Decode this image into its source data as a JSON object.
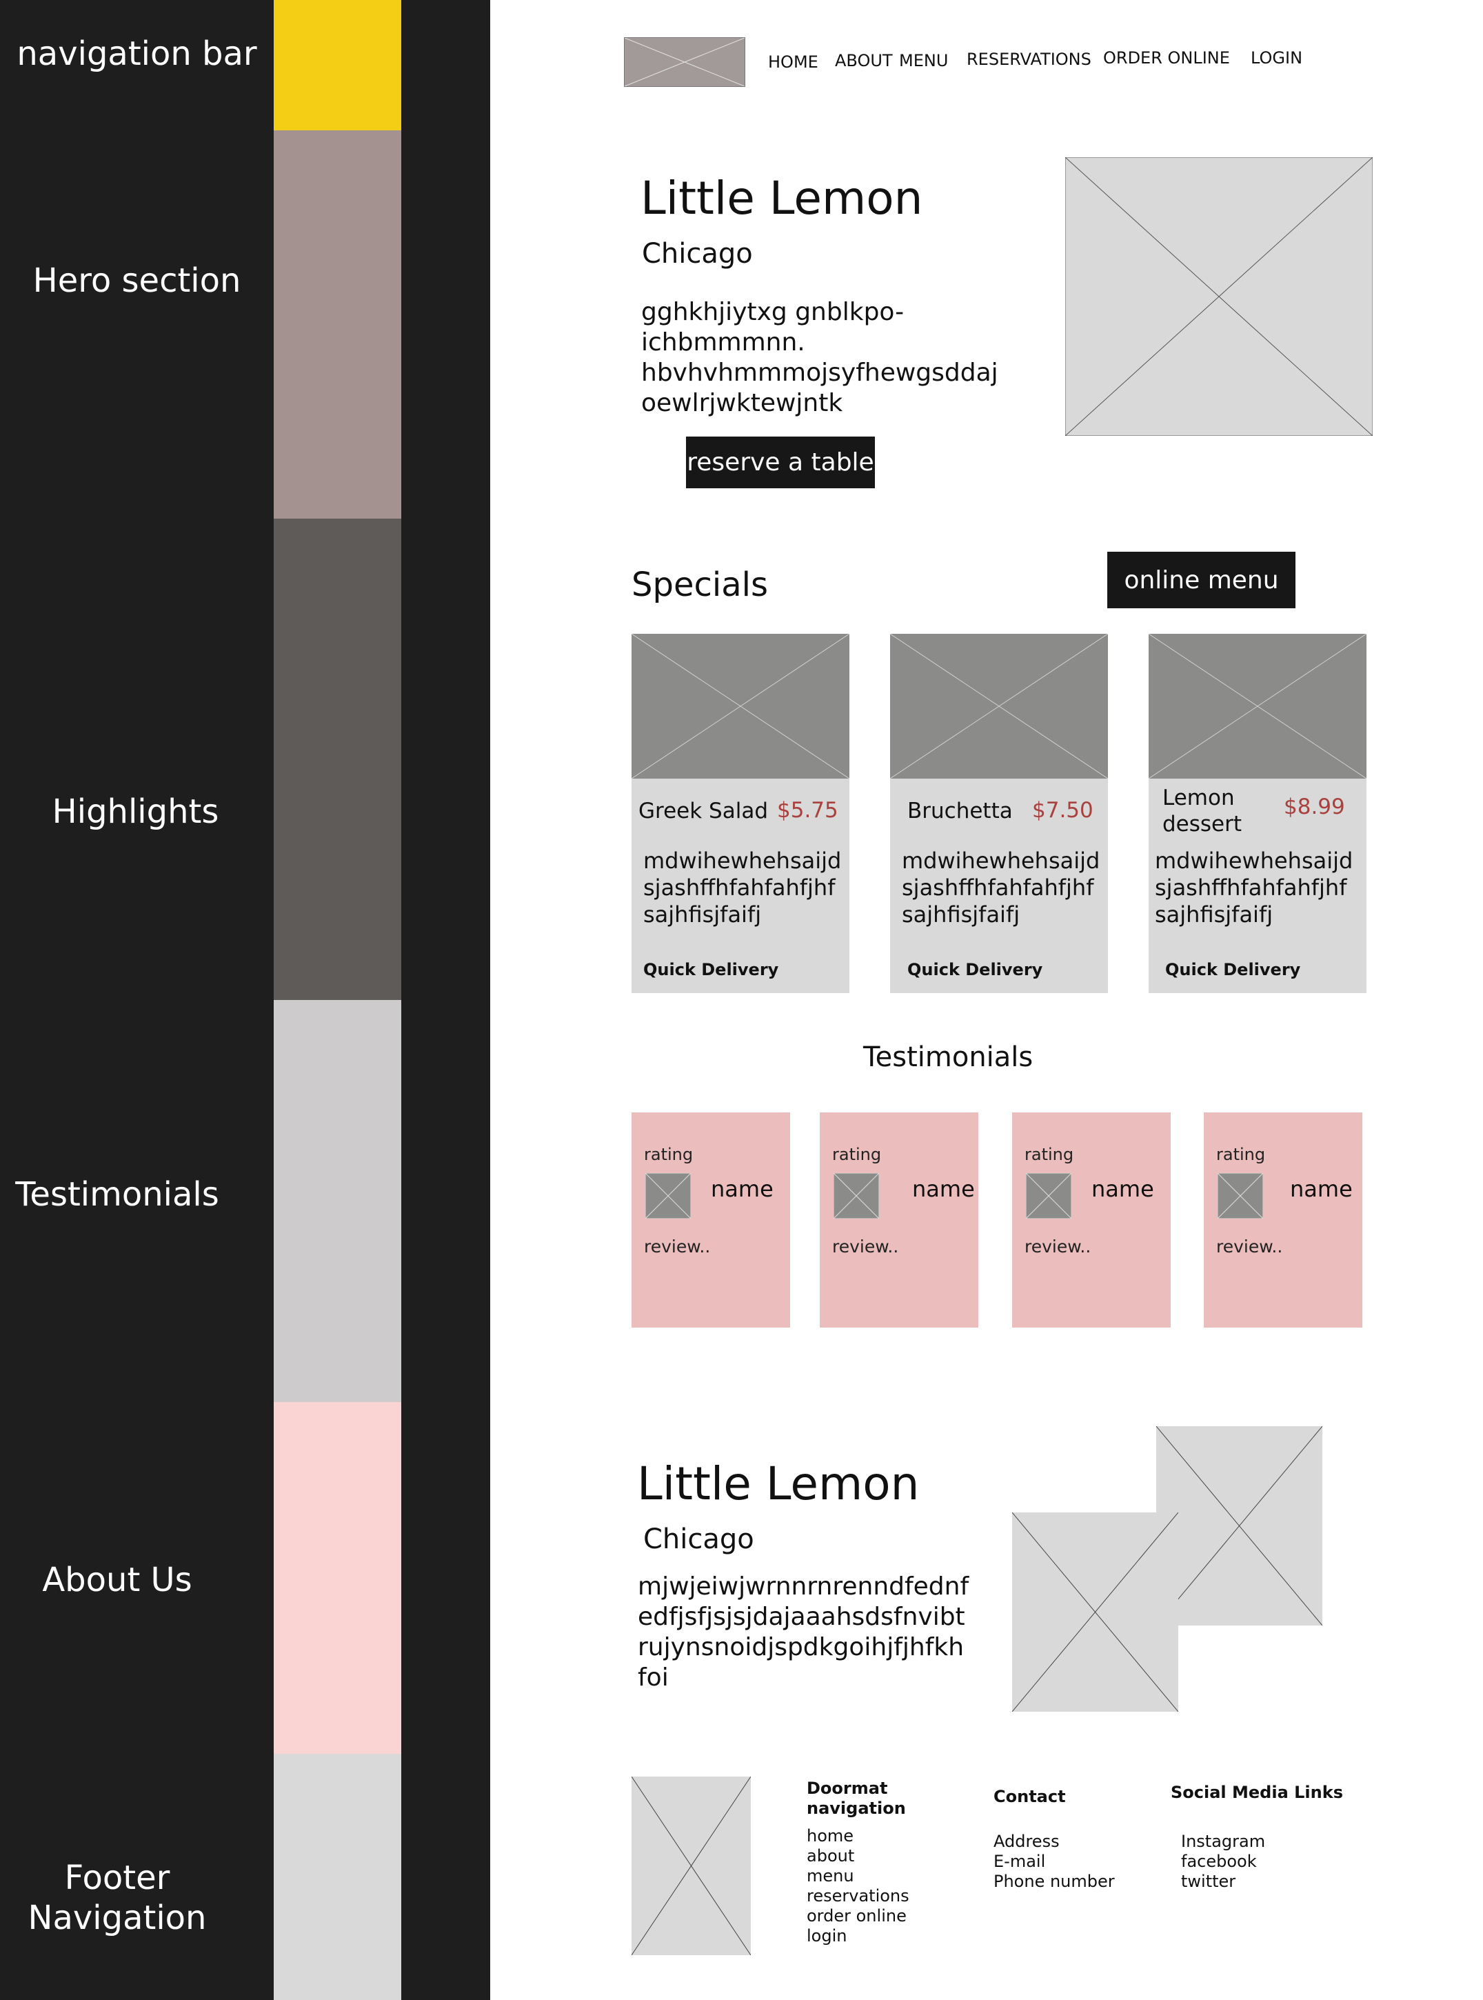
{
  "legend": {
    "colors": {
      "navigation_bar": "#f4ce14",
      "hero_section": "#a3928f",
      "highlights": "#5e5b58",
      "testimonials": "#cdcbcc",
      "about_us": "#fad4d3",
      "footer_navigation": "#dad9d9"
    },
    "navigation_bar": "navigation bar",
    "hero_section": "Hero section",
    "highlights": "Highlights",
    "testimonials": "Testimonials",
    "about_us": "About Us",
    "footer_navigation_line1": "Footer",
    "footer_navigation_line2": "Navigation"
  },
  "nav": {
    "logo_icon": "logo-placeholder-icon",
    "items": [
      "HOME",
      "ABOUT",
      "MENU",
      "RESERVATIONS",
      "ORDER ONLINE",
      "LOGIN"
    ]
  },
  "hero": {
    "title": "Little Lemon",
    "subtitle": "Chicago",
    "description_lines": [
      "gghkhjiytxg gnblkpo-",
      "ichbmmmnn.",
      "hbvhvhmmmojsyfhewgsddaj",
      "oewlrjwktewjntk"
    ],
    "cta_label": "reserve a table",
    "image_icon": "image-placeholder-icon"
  },
  "specials": {
    "heading": "Specials",
    "menu_button_label": "online menu",
    "items": [
      {
        "name": "Greek Salad",
        "price": "$5.75",
        "description": "mdwihewhehsaijd\nsjashffhfahfahfjhf\nsajhfisjfaifj",
        "footer": "Quick Delivery"
      },
      {
        "name": "Bruchetta",
        "price": "$7.50",
        "description": "mdwihewhehsaijd\nsjashffhfahfahfjhf\nsajhfisjfaifj",
        "footer": "Quick Delivery"
      },
      {
        "name": "Lemon\ndessert",
        "price": "$8.99",
        "description": "mdwihewhehsaijd\nsjashffhfahfahfjhf\nsajhfisjfaifj",
        "footer": "Quick Delivery"
      }
    ],
    "accent_price_color": "#a9423e"
  },
  "testimonials": {
    "heading": "Testimonials",
    "cards": [
      {
        "rating": "rating",
        "name": "name",
        "review": "review.."
      },
      {
        "rating": "rating",
        "name": "name",
        "review": "review.."
      },
      {
        "rating": "rating",
        "name": "name",
        "review": "review.."
      },
      {
        "rating": "rating",
        "name": "name",
        "review": "review.."
      }
    ],
    "card_color": "#ebbdbd"
  },
  "about": {
    "title": "Little Lemon",
    "subtitle": "Chicago",
    "description_lines": [
      "mjwjeiwjwrnnrnrenndfednf",
      "edfjsfjsjsjdajaaahsdsfnvibt",
      "rujynsnoidjspdkgoihjfjhfkh",
      "foi"
    ]
  },
  "footer": {
    "doormat_heading_line1": "Doormat",
    "doormat_heading_line2": "navigation",
    "doormat_links": [
      "home",
      "about",
      "menu",
      "reservations",
      "order online",
      "login"
    ],
    "contact_heading": "Contact",
    "contact_items": [
      "Address",
      "E-mail",
      "Phone number"
    ],
    "social_heading": "Social Media Links",
    "social_links": [
      "Instagram",
      "facebook",
      "twitter"
    ]
  }
}
